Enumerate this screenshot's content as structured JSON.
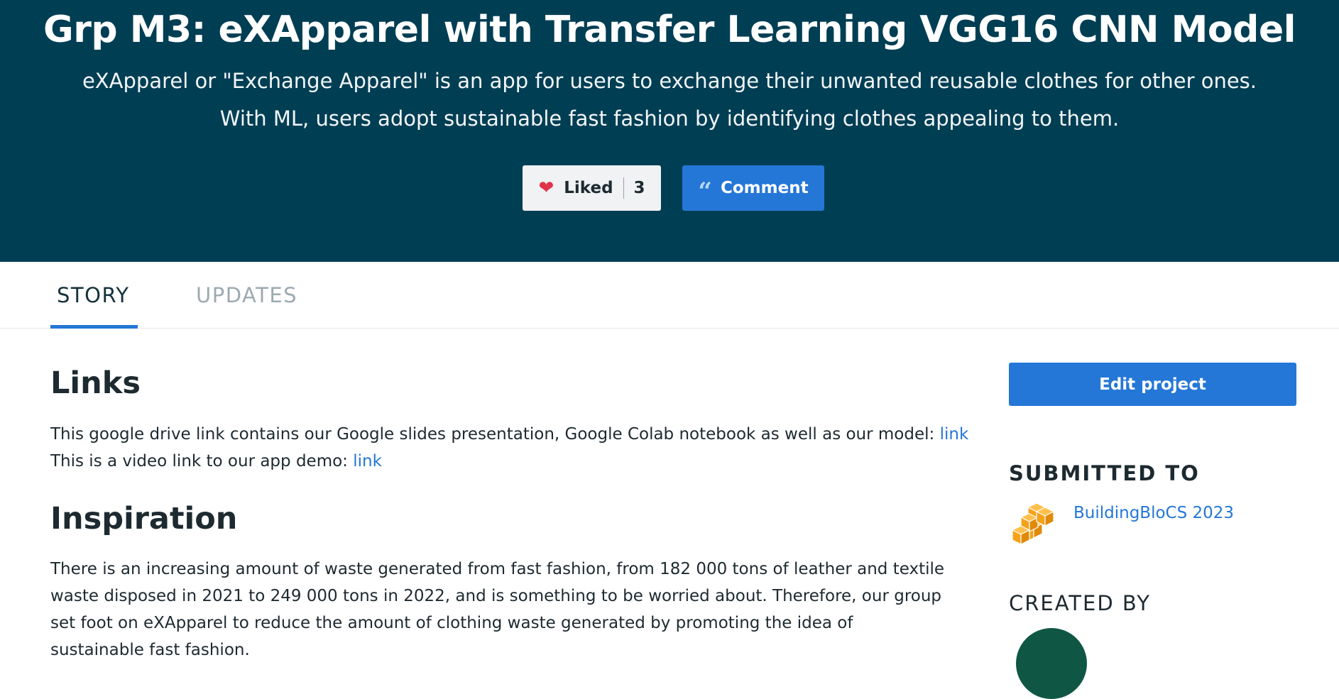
{
  "hero": {
    "title": "Grp M3: eXApparel with Transfer Learning VGG16 CNN Model",
    "tagline": "eXApparel or \"Exchange Apparel\" is an app for users to exchange their unwanted reusable clothes for other ones. With ML, users adopt sustainable fast fashion by identifying clothes appealing to them.",
    "like_button": {
      "label": "Liked",
      "count": "3",
      "icon": "heart-icon"
    },
    "comment_button": {
      "label": "Comment",
      "icon": "quote-icon"
    }
  },
  "tabs": [
    {
      "label": "STORY",
      "active": true
    },
    {
      "label": "UPDATES",
      "active": false
    }
  ],
  "story": {
    "links": {
      "heading": "Links",
      "text_1": "This google drive link contains our Google slides presentation, Google Colab notebook as well as our model: ",
      "link_1": "link",
      "text_2": " This is a video link to our app demo: ",
      "link_2": "link"
    },
    "inspiration": {
      "heading": "Inspiration",
      "text": "There is an increasing amount of waste generated from fast fashion, from 182 000 tons of leather and textile waste disposed in 2021 to 249 000 tons in 2022, and is something to be worried about. Therefore, our group set foot on eXApparel to reduce the amount of clothing waste generated by promoting the idea of sustainable fast fashion."
    }
  },
  "sidebar": {
    "edit_button": "Edit project",
    "submitted_heading": "SUBMITTED TO",
    "hackathon": {
      "name": "BuildingBloCS 2023",
      "icon": "stacked-cubes-logo"
    },
    "created_heading": "CREATED BY"
  },
  "colors": {
    "hero_bg": "#003e54",
    "accent_blue": "#2477d6",
    "heart_red": "#e0344b",
    "logo_orange": "#f5a21b"
  }
}
